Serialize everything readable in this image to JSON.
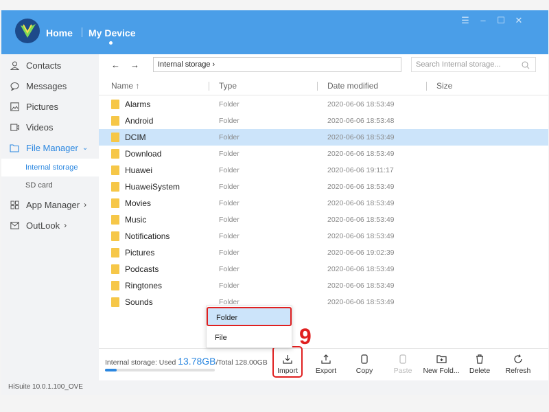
{
  "header": {
    "home_label": "Home",
    "device_label": "My Device"
  },
  "sidebar": {
    "items": [
      {
        "label": "Contacts",
        "icon": "person-icon"
      },
      {
        "label": "Messages",
        "icon": "chat-bubble-icon"
      },
      {
        "label": "Pictures",
        "icon": "image-icon"
      },
      {
        "label": "Videos",
        "icon": "video-icon"
      },
      {
        "label": "File Manager",
        "icon": "folder-icon"
      },
      {
        "label": "App Manager",
        "icon": "grid-icon"
      },
      {
        "label": "OutLook",
        "icon": "mail-icon"
      }
    ],
    "sub_items": [
      "Internal storage",
      "SD card"
    ]
  },
  "toolbar": {
    "back_arrow": "←",
    "forward_arrow": "→",
    "path": "Internal storage ›",
    "search_placeholder": "Search Internal storage..."
  },
  "columns": {
    "name": "Name ↑",
    "type": "Type",
    "date": "Date modified",
    "size": "Size"
  },
  "files": [
    {
      "name": "Alarms",
      "type": "Folder",
      "date": "2020-06-06 18:53:49"
    },
    {
      "name": "Android",
      "type": "Folder",
      "date": "2020-06-06 18:53:48"
    },
    {
      "name": "DCIM",
      "type": "Folder",
      "date": "2020-06-06 18:53:49"
    },
    {
      "name": "Download",
      "type": "Folder",
      "date": "2020-06-06 18:53:49"
    },
    {
      "name": "Huawei",
      "type": "Folder",
      "date": "2020-06-06 19:11:17"
    },
    {
      "name": "HuaweiSystem",
      "type": "Folder",
      "date": "2020-06-06 18:53:49"
    },
    {
      "name": "Movies",
      "type": "Folder",
      "date": "2020-06-06 18:53:49"
    },
    {
      "name": "Music",
      "type": "Folder",
      "date": "2020-06-06 18:53:49"
    },
    {
      "name": "Notifications",
      "type": "Folder",
      "date": "2020-06-06 18:53:49"
    },
    {
      "name": "Pictures",
      "type": "Folder",
      "date": "2020-06-06 19:02:39"
    },
    {
      "name": "Podcasts",
      "type": "Folder",
      "date": "2020-06-06 18:53:49"
    },
    {
      "name": "Ringtones",
      "type": "Folder",
      "date": "2020-06-06 18:53:49"
    },
    {
      "name": "Sounds",
      "type": "Folder",
      "date": "2020-06-06 18:53:49"
    }
  ],
  "popup": {
    "folder_label": "Folder",
    "file_label": "File"
  },
  "annotation": "9",
  "storage": {
    "prefix": "Internal storage: Used ",
    "used": "13.78GB",
    "total": "/Total 128.00GB",
    "used_fraction": 0.108
  },
  "actions": {
    "import": "Import",
    "export": "Export",
    "copy": "Copy",
    "paste": "Paste",
    "new_folder": "New Fold...",
    "delete": "Delete",
    "refresh": "Refresh"
  },
  "status": "HiSuite 10.0.1.100_OVE",
  "colors": {
    "header_blue": "#4a9ee8",
    "accent_blue": "#2b87e0",
    "highlight_red": "#e02020",
    "folder_yellow": "#f6c748",
    "selection_blue": "#cce4fa"
  }
}
